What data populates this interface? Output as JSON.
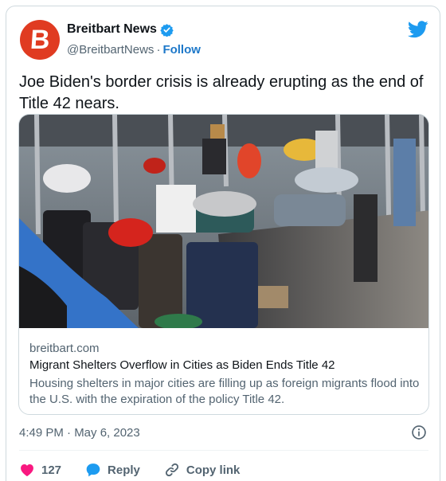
{
  "author": {
    "name": "Breitbart News",
    "handle": "@BreitbartNews",
    "separator": "·",
    "follow_label": "Follow",
    "avatar_letter": "B"
  },
  "tweet": {
    "text": "Joe Biden's border crisis is already erupting as the end of Title 42 nears.",
    "timestamp": "4:49 PM · May 6, 2023"
  },
  "link_card": {
    "domain": "breitbart.com",
    "title": "Migrant Shelters Overflow in Cities as Biden Ends Title 42",
    "description": "Housing shelters in major cities are filling up as foreign migrants flood into the U.S. with the expiration of the policy Title 42."
  },
  "actions": {
    "like_count": "127",
    "reply_label": "Reply",
    "copy_link_label": "Copy link"
  },
  "colors": {
    "brand_red": "#e03b21",
    "twitter_blue": "#1d9bf0",
    "like_pink": "#f91880"
  },
  "icons": [
    "verified-badge-icon",
    "twitter-bird-icon",
    "info-icon",
    "heart-icon",
    "reply-icon",
    "link-icon"
  ]
}
